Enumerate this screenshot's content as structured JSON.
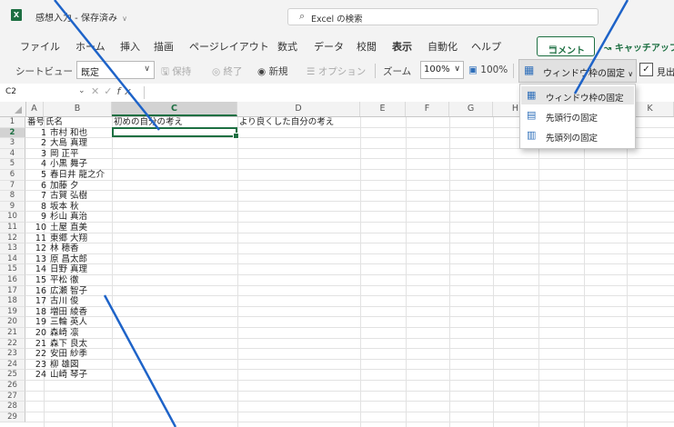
{
  "window": {
    "app_icon": "excel-logo",
    "app_letter": "X",
    "title": "感想入力 - 保存済み",
    "title_chevron": "∨"
  },
  "search": {
    "placeholder": "Excel の検索",
    "icon": "search-icon"
  },
  "menu": {
    "tabs": [
      "ファイル",
      "ホーム",
      "挿入",
      "描画",
      "ページレイアウト",
      "数式",
      "データ",
      "校閲",
      "表示",
      "自動化",
      "ヘルプ"
    ],
    "active_tab": "表示",
    "comment_label": "コメント",
    "catchup_label": "キャッチアップ"
  },
  "toolbar": {
    "sheet_view_label": "シートビュー",
    "sheet_view_value": "既定",
    "keep_label": "保持",
    "exit_label": "終了",
    "new_label": "新規",
    "options_label": "オプション",
    "zoom_label": "ズーム",
    "zoom_value": "100%",
    "zoom100_label": "100%",
    "freeze_label": "ウィンドウ枠の固定",
    "gridlines_checked": true,
    "gridlines_label": "見出し"
  },
  "formula_bar": {
    "name_box": "C2",
    "cancel": "✕",
    "enter": "✓",
    "fx": "fx",
    "content": ""
  },
  "freeze_menu": {
    "items": [
      "ウィンドウ枠の固定",
      "先頭行の固定",
      "先頭列の固定"
    ],
    "highlighted_index": 0
  },
  "sheet": {
    "columns": [
      "A",
      "B",
      "C",
      "D",
      "E",
      "F",
      "G",
      "H",
      "I",
      "J",
      "K"
    ],
    "selected_column": "C",
    "selected_row": 2,
    "header_row": {
      "A": "番号",
      "B": "氏名",
      "C": "初めの自分の考え",
      "D": "より良くした自分の考え"
    },
    "rows": [
      {
        "no": 1,
        "name": "市村 和也"
      },
      {
        "no": 2,
        "name": "大島 真理"
      },
      {
        "no": 3,
        "name": "岡 正平"
      },
      {
        "no": 4,
        "name": "小黒 舞子"
      },
      {
        "no": 5,
        "name": "春日井 龍之介"
      },
      {
        "no": 6,
        "name": "加藤 夕"
      },
      {
        "no": 7,
        "name": "古賀 弘樹"
      },
      {
        "no": 8,
        "name": "坂本 秋"
      },
      {
        "no": 9,
        "name": "杉山 真治"
      },
      {
        "no": 10,
        "name": "土屋 直美"
      },
      {
        "no": 11,
        "name": "東郷 大翔"
      },
      {
        "no": 12,
        "name": "林 穂香"
      },
      {
        "no": 13,
        "name": "原 昌太郎"
      },
      {
        "no": 14,
        "name": "日野 真理"
      },
      {
        "no": 15,
        "name": "平松 徹"
      },
      {
        "no": 16,
        "name": "広瀬 智子"
      },
      {
        "no": 17,
        "name": "古川 俊"
      },
      {
        "no": 18,
        "name": "増田 綾香"
      },
      {
        "no": 19,
        "name": "三輪 英人"
      },
      {
        "no": 20,
        "name": "森崎 凛"
      },
      {
        "no": 21,
        "name": "森下 良太"
      },
      {
        "no": 22,
        "name": "安田 紗季"
      },
      {
        "no": 23,
        "name": "柳 雄図"
      },
      {
        "no": 24,
        "name": "山崎 琴子"
      }
    ],
    "total_rows_visible": 29
  },
  "colors": {
    "accent": "#1d6f42",
    "callout": "#1e63c8",
    "icon_blue": "#2f6fba"
  }
}
